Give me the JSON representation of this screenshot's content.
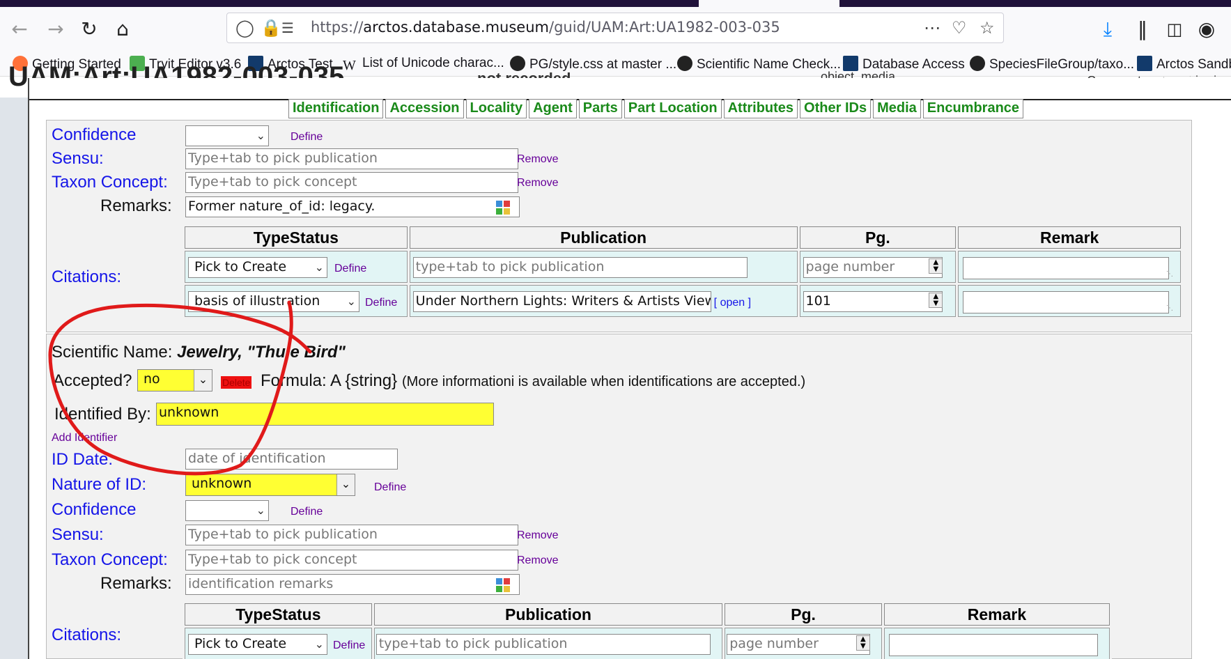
{
  "browser": {
    "url_prefix": "https://",
    "url_host": "arctos.database.museum",
    "url_path": "/guid/UAM:Art:UA1982-003-035",
    "bookmarks": [
      "Getting Started",
      "Tryit Editor v3.6",
      "Arctos Test",
      "List of Unicode charac...",
      "PG/style.css at master ...",
      "Scientific Name Check...",
      "Database Access",
      "SpeciesFileGroup/taxo...",
      "Arctos Sandb"
    ]
  },
  "background": {
    "title": "UAM:Art:UA1982-003-035",
    "fragments": [
      "not recorded",
      "object, media",
      "Comment or report bad"
    ]
  },
  "tabs": [
    "Identification",
    "Accession",
    "Locality",
    "Agent",
    "Parts",
    "Part Location",
    "Attributes",
    "Other IDs",
    "Media",
    "Encumbrance"
  ],
  "id1": {
    "confidence_label": "Confidence",
    "define": "Define",
    "sensu_label": "Sensu:",
    "sensu_placeholder": "Type+tab to pick publication",
    "remove": "Remove",
    "taxon_concept_label": "Taxon Concept:",
    "taxon_concept_placeholder": "Type+tab to pick concept",
    "remarks_label": "Remarks:",
    "remarks_value": "Former nature_of_id: legacy.",
    "citations_label": "Citations:",
    "citation_headers": [
      "TypeStatus",
      "Publication",
      "Pg.",
      "Remark"
    ],
    "cit_row1": {
      "typestatus": "Pick to Create",
      "define": "Define",
      "publication_placeholder": "type+tab to pick publication",
      "page_placeholder": "page number"
    },
    "cit_row2": {
      "typestatus": "basis of illustration",
      "define": "Define",
      "publication": "Under Northern Lights: Writers & Artists View the Alas",
      "open": "[ open ]",
      "page": "101"
    }
  },
  "id2": {
    "scientific_name_label": "Scientific Name:",
    "scientific_name": "Jewelry, \"Thule Bird\"",
    "accepted_label": "Accepted?",
    "accepted_value": "no",
    "delete": "Delete",
    "formula_label": "Formula: A {string}",
    "formula_note": "(More informationi is available when identifications are accepted.)",
    "identified_by_label": "Identified By:",
    "identified_by_value": "unknown",
    "add_identifier": "Add Identifier",
    "id_date_label": "ID Date:",
    "id_date_placeholder": "date of identification",
    "nature_label": "Nature of ID:",
    "nature_value": "unknown",
    "define": "Define",
    "confidence_label": "Confidence",
    "sensu_label": "Sensu:",
    "sensu_placeholder": "Type+tab to pick publication",
    "remove": "Remove",
    "taxon_concept_label": "Taxon Concept:",
    "taxon_concept_placeholder": "Type+tab to pick concept",
    "remarks_label": "Remarks:",
    "remarks_placeholder": "identification remarks",
    "citations_label": "Citations:",
    "citation_headers": [
      "TypeStatus",
      "Publication",
      "Pg.",
      "Remark"
    ],
    "cit_row1": {
      "typestatus": "Pick to Create",
      "define": "Define",
      "publication_placeholder": "type+tab to pick publication",
      "page_placeholder": "page number"
    }
  },
  "colors": {
    "label_blue": "#1515e8",
    "tab_green": "#1a8a1a",
    "link_purple": "#660099",
    "highlight_yellow": "#ffff33",
    "annotation_red": "#e01a1a",
    "citation_cell": "#e2f5f5"
  },
  "icons": [
    "back-arrow-icon",
    "forward-arrow-icon",
    "reload-icon",
    "home-icon",
    "shield-icon",
    "lock-icon",
    "more-icon",
    "pocket-icon",
    "star-icon",
    "download-icon",
    "library-icon",
    "sidebar-icon",
    "account-icon",
    "widget-icon"
  ]
}
